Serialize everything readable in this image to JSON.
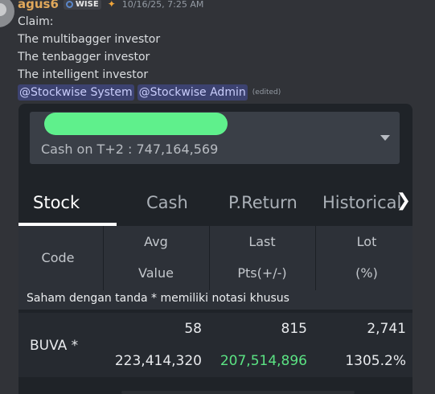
{
  "message": {
    "username": "agus6",
    "tag": "WISE",
    "timestamp": "10/16/25, 7:25 AM",
    "lines": [
      "Claim:",
      "The multibagger investor",
      "The tenbagger investor",
      "The intelligent investor"
    ],
    "mentions": [
      "@Stockwise System",
      "@Stockwise Admin"
    ],
    "edited": "(edited)"
  },
  "card": {
    "selector_text": "Cash on T+2 : 747,164,569",
    "tabs": [
      "Stock",
      "Cash",
      "P.Return",
      "Historical"
    ],
    "active_tab": "Stock",
    "headers": {
      "code": "Code",
      "avg": "Avg",
      "value": "Value",
      "last": "Last",
      "pts": "Pts(+/-)",
      "lot": "Lot",
      "pct": "(%)"
    },
    "note": "Saham dengan tanda * memiliki notasi khusus",
    "rows": [
      {
        "code": "BUVA *",
        "avg": "58",
        "last": "815",
        "lot": "2,741",
        "value": "223,414,320",
        "pts": "207,514,896",
        "pct": "1305.2%"
      }
    ]
  }
}
